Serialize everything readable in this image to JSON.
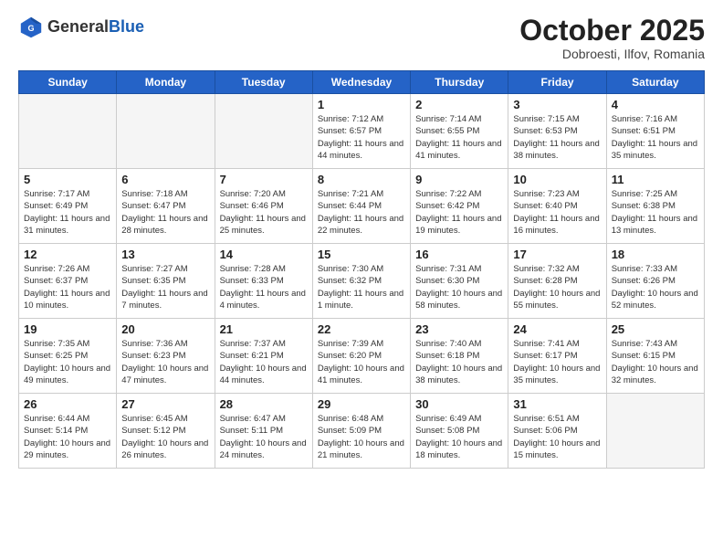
{
  "header": {
    "logo_line1": "General",
    "logo_line2": "Blue",
    "title": "October 2025",
    "subtitle": "Dobroesti, Ilfov, Romania"
  },
  "days_of_week": [
    "Sunday",
    "Monday",
    "Tuesday",
    "Wednesday",
    "Thursday",
    "Friday",
    "Saturday"
  ],
  "weeks": [
    [
      {
        "day": "",
        "info": ""
      },
      {
        "day": "",
        "info": ""
      },
      {
        "day": "",
        "info": ""
      },
      {
        "day": "1",
        "info": "Sunrise: 7:12 AM\nSunset: 6:57 PM\nDaylight: 11 hours and 44 minutes."
      },
      {
        "day": "2",
        "info": "Sunrise: 7:14 AM\nSunset: 6:55 PM\nDaylight: 11 hours and 41 minutes."
      },
      {
        "day": "3",
        "info": "Sunrise: 7:15 AM\nSunset: 6:53 PM\nDaylight: 11 hours and 38 minutes."
      },
      {
        "day": "4",
        "info": "Sunrise: 7:16 AM\nSunset: 6:51 PM\nDaylight: 11 hours and 35 minutes."
      }
    ],
    [
      {
        "day": "5",
        "info": "Sunrise: 7:17 AM\nSunset: 6:49 PM\nDaylight: 11 hours and 31 minutes."
      },
      {
        "day": "6",
        "info": "Sunrise: 7:18 AM\nSunset: 6:47 PM\nDaylight: 11 hours and 28 minutes."
      },
      {
        "day": "7",
        "info": "Sunrise: 7:20 AM\nSunset: 6:46 PM\nDaylight: 11 hours and 25 minutes."
      },
      {
        "day": "8",
        "info": "Sunrise: 7:21 AM\nSunset: 6:44 PM\nDaylight: 11 hours and 22 minutes."
      },
      {
        "day": "9",
        "info": "Sunrise: 7:22 AM\nSunset: 6:42 PM\nDaylight: 11 hours and 19 minutes."
      },
      {
        "day": "10",
        "info": "Sunrise: 7:23 AM\nSunset: 6:40 PM\nDaylight: 11 hours and 16 minutes."
      },
      {
        "day": "11",
        "info": "Sunrise: 7:25 AM\nSunset: 6:38 PM\nDaylight: 11 hours and 13 minutes."
      }
    ],
    [
      {
        "day": "12",
        "info": "Sunrise: 7:26 AM\nSunset: 6:37 PM\nDaylight: 11 hours and 10 minutes."
      },
      {
        "day": "13",
        "info": "Sunrise: 7:27 AM\nSunset: 6:35 PM\nDaylight: 11 hours and 7 minutes."
      },
      {
        "day": "14",
        "info": "Sunrise: 7:28 AM\nSunset: 6:33 PM\nDaylight: 11 hours and 4 minutes."
      },
      {
        "day": "15",
        "info": "Sunrise: 7:30 AM\nSunset: 6:32 PM\nDaylight: 11 hours and 1 minute."
      },
      {
        "day": "16",
        "info": "Sunrise: 7:31 AM\nSunset: 6:30 PM\nDaylight: 10 hours and 58 minutes."
      },
      {
        "day": "17",
        "info": "Sunrise: 7:32 AM\nSunset: 6:28 PM\nDaylight: 10 hours and 55 minutes."
      },
      {
        "day": "18",
        "info": "Sunrise: 7:33 AM\nSunset: 6:26 PM\nDaylight: 10 hours and 52 minutes."
      }
    ],
    [
      {
        "day": "19",
        "info": "Sunrise: 7:35 AM\nSunset: 6:25 PM\nDaylight: 10 hours and 49 minutes."
      },
      {
        "day": "20",
        "info": "Sunrise: 7:36 AM\nSunset: 6:23 PM\nDaylight: 10 hours and 47 minutes."
      },
      {
        "day": "21",
        "info": "Sunrise: 7:37 AM\nSunset: 6:21 PM\nDaylight: 10 hours and 44 minutes."
      },
      {
        "day": "22",
        "info": "Sunrise: 7:39 AM\nSunset: 6:20 PM\nDaylight: 10 hours and 41 minutes."
      },
      {
        "day": "23",
        "info": "Sunrise: 7:40 AM\nSunset: 6:18 PM\nDaylight: 10 hours and 38 minutes."
      },
      {
        "day": "24",
        "info": "Sunrise: 7:41 AM\nSunset: 6:17 PM\nDaylight: 10 hours and 35 minutes."
      },
      {
        "day": "25",
        "info": "Sunrise: 7:43 AM\nSunset: 6:15 PM\nDaylight: 10 hours and 32 minutes."
      }
    ],
    [
      {
        "day": "26",
        "info": "Sunrise: 6:44 AM\nSunset: 5:14 PM\nDaylight: 10 hours and 29 minutes."
      },
      {
        "day": "27",
        "info": "Sunrise: 6:45 AM\nSunset: 5:12 PM\nDaylight: 10 hours and 26 minutes."
      },
      {
        "day": "28",
        "info": "Sunrise: 6:47 AM\nSunset: 5:11 PM\nDaylight: 10 hours and 24 minutes."
      },
      {
        "day": "29",
        "info": "Sunrise: 6:48 AM\nSunset: 5:09 PM\nDaylight: 10 hours and 21 minutes."
      },
      {
        "day": "30",
        "info": "Sunrise: 6:49 AM\nSunset: 5:08 PM\nDaylight: 10 hours and 18 minutes."
      },
      {
        "day": "31",
        "info": "Sunrise: 6:51 AM\nSunset: 5:06 PM\nDaylight: 10 hours and 15 minutes."
      },
      {
        "day": "",
        "info": ""
      }
    ]
  ]
}
